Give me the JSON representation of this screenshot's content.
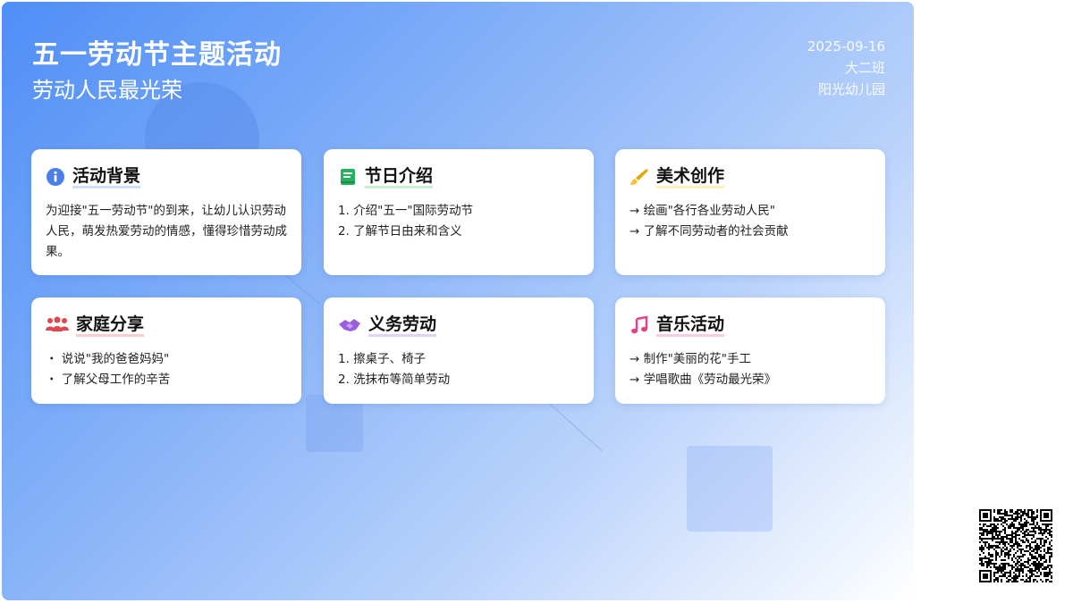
{
  "header": {
    "title": "五一劳动节主题活动",
    "subtitle": "劳动人民最光荣",
    "date": "2025-09-16",
    "class": "大二班",
    "school": "阳光幼儿园"
  },
  "cards": [
    {
      "title": "活动背景",
      "icon": "info-icon",
      "accent": "#cfe0fb",
      "paragraph": "为迎接\"五一劳动节\"的到来，让幼儿认识劳动人民，萌发热爱劳动的情感，懂得珍惜劳动成果。"
    },
    {
      "title": "节日介绍",
      "icon": "book-icon",
      "accent": "#c9f0d4",
      "lines": [
        "1. 介绍\"五一\"国际劳动节",
        "2. 了解节日由来和含义"
      ]
    },
    {
      "title": "美术创作",
      "icon": "paintbrush-icon",
      "accent": "#fbeeb8",
      "lines": [
        "→ 绘画\"各行各业劳动人民\"",
        "→ 了解不同劳动者的社会贡献"
      ]
    },
    {
      "title": "家庭分享",
      "icon": "family-icon",
      "accent": "#f8cdd0",
      "lines": [
        "・ 说说\"我的爸爸妈妈\"",
        "・ 了解父母工作的辛苦"
      ]
    },
    {
      "title": "义务劳动",
      "icon": "handshake-icon",
      "accent": "#e2d2f8",
      "lines": [
        "1. 擦桌子、椅子",
        "2. 洗抹布等简单劳动"
      ]
    },
    {
      "title": "音乐活动",
      "icon": "music-note-icon",
      "accent": "#f8cce0",
      "lines": [
        "→ 制作\"美丽的花\"手工",
        "→ 学唱歌曲《劳动最光荣》"
      ]
    }
  ]
}
